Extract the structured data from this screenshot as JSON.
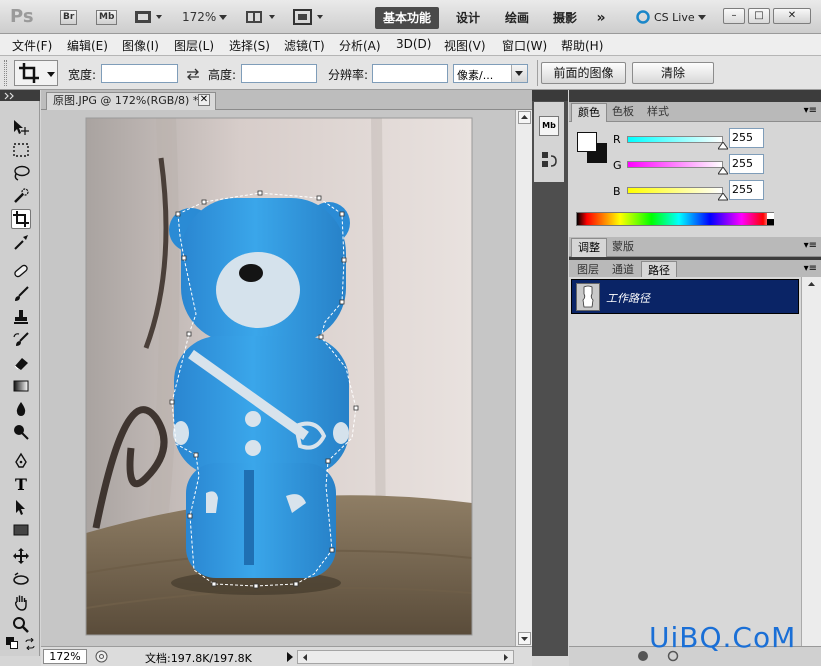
{
  "appbar": {
    "ps_logo": "Ps",
    "br_label": "Br",
    "mb_label": "Mb",
    "zoom": "172%",
    "workspaces": [
      "基本功能",
      "设计",
      "绘画",
      "摄影"
    ],
    "active_workspace": "基本功能",
    "more": "»",
    "cs_live": "CS Live",
    "window_buttons": [
      "–",
      "□",
      "✕"
    ]
  },
  "menu": {
    "items": [
      "文件(F)",
      "编辑(E)",
      "图像(I)",
      "图层(L)",
      "选择(S)",
      "滤镜(T)",
      "分析(A)",
      "3D(D)",
      "视图(V)",
      "窗口(W)",
      "帮助(H)"
    ]
  },
  "options": {
    "width_label": "宽度:",
    "width_value": "",
    "height_label": "高度:",
    "height_value": "",
    "resolution_label": "分辨率:",
    "resolution_value": "",
    "unit_value": "像素/...",
    "front_image_button": "前面的图像",
    "clear_button": "清除"
  },
  "document": {
    "tab_title": "原图.JPG @ 172%(RGB/8) *",
    "zoom_status": "172%",
    "doc_info": "文档:197.8K/197.8K"
  },
  "color_panel": {
    "tabs": [
      "颜色",
      "色板",
      "样式"
    ],
    "active_tab": "颜色",
    "channels": [
      {
        "label": "R",
        "value": "255"
      },
      {
        "label": "G",
        "value": "255"
      },
      {
        "label": "B",
        "value": "255"
      }
    ]
  },
  "adjust_panel": {
    "tabs": [
      "调整",
      "蒙版"
    ],
    "active_tab": "调整"
  },
  "layers_panel": {
    "tabs": [
      "图层",
      "通道",
      "路径"
    ],
    "active_tab": "路径",
    "path_item": "工作路径"
  },
  "watermark": "UiBQ.CoM",
  "colors": {
    "path_selected": "#0a2466",
    "bear_blue": "#2f9ae0",
    "watermark": "#1a6fd6"
  }
}
